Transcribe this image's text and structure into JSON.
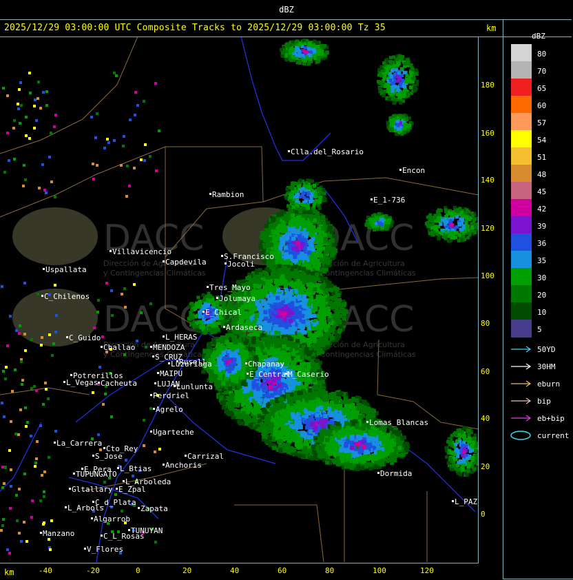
{
  "window": {
    "title": "dBZ"
  },
  "header": {
    "text": "2025/12/29 03:00:00 UTC Composite Tracks to 2025/12/29 03:00:00 Tz 35",
    "unit": "km"
  },
  "axes": {
    "y_ticks": [
      "180",
      "160",
      "140",
      "120",
      "100",
      "80",
      "60",
      "40",
      "20",
      "0"
    ],
    "x_ticks": [
      "-40",
      "-20",
      "0",
      "20",
      "40",
      "60",
      "80",
      "100",
      "120"
    ],
    "unit": "km"
  },
  "legend": {
    "title": "dBZ",
    "levels": [
      {
        "value": "80",
        "color": "#d4d4d4"
      },
      {
        "value": "70",
        "color": "#b4b4b4"
      },
      {
        "value": "65",
        "color": "#f02020"
      },
      {
        "value": "60",
        "color": "#ff6a00"
      },
      {
        "value": "57",
        "color": "#ff9a5a"
      },
      {
        "value": "54",
        "color": "#ffff00"
      },
      {
        "value": "51",
        "color": "#f4c030"
      },
      {
        "value": "48",
        "color": "#d88c30"
      },
      {
        "value": "45",
        "color": "#c86480"
      },
      {
        "value": "42",
        "color": "#d000a0"
      },
      {
        "value": "39",
        "color": "#7a14d0"
      },
      {
        "value": "36",
        "color": "#2050e0"
      },
      {
        "value": "35",
        "color": "#1890e0"
      },
      {
        "value": "30",
        "color": "#00a000"
      },
      {
        "value": "20",
        "color": "#007800"
      },
      {
        "value": "10",
        "color": "#004c00"
      },
      {
        "value": "5",
        "color": "#483c8c"
      }
    ],
    "tracks": [
      {
        "label": "50YD",
        "color": "#40d8e8"
      },
      {
        "label": "30HM",
        "color": "#ffffff"
      },
      {
        "label": "eburn",
        "color": "#f0c060"
      },
      {
        "label": "bip",
        "color": "#f0c0c0"
      },
      {
        "label": "eb+bip",
        "color": "#e040e0"
      },
      {
        "label": "current",
        "color": "#40d8e8"
      }
    ]
  },
  "watermark": {
    "text": "DACC",
    "sub1": "Dirección de Agricultura",
    "sub2": "y Contingencias Climáticas"
  },
  "places": [
    "Clla.del_Rosario",
    "Encon",
    "E_1-736",
    "Rambion",
    "Villavicencio",
    "Capdevila",
    "S.Francisco",
    "Uspallata",
    "Jocoli",
    "Tres_Mayo",
    "C_Chilenos",
    "Jolumaya",
    "E_Chical",
    "L_HERAS",
    "Ardaseca",
    "C_Guido",
    "MENDOZA",
    "Challao",
    "S_CRUZ",
    "Luzuriaga",
    "MAIPU",
    "Potrerillos",
    "Cacheuta",
    "L_Vegas",
    "LUJAN",
    "Perdriel",
    "Agrelo",
    "Ugarteche",
    "La_Carrera",
    "Cto_Rey",
    "S_Jose",
    "E_Pera",
    "L_Btias",
    "Anchoris",
    "TUPUNGATO",
    "L_Arboleda",
    "Gltallary",
    "E_Zpal",
    "C_d_Plata",
    "L_Arbols",
    "Zapata",
    "Algarrob",
    "TUNUYAN",
    "Manzano",
    "C_L_Rosas",
    "V_Flores",
    "Lomas_Blancas",
    "Dormida",
    "L_PAZ",
    "Carrizal",
    "Rusell",
    "Lunlunta",
    "M_Caserio",
    "Chapanay",
    "E_Central"
  ]
}
